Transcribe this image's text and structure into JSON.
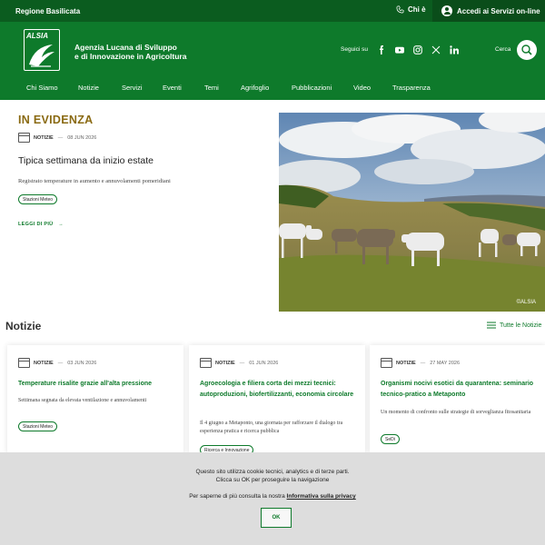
{
  "topbar": {
    "region": "Regione Basilicata",
    "chi_e": "Chi è",
    "login": "Accedi ai Servizi on-line"
  },
  "header": {
    "logo_text": "ALSIA",
    "agency_line1": "Agenzia Lucana di Sviluppo",
    "agency_line2": "e di Innovazione in Agricoltura",
    "follow": "Seguici su",
    "social": [
      "facebook",
      "youtube",
      "instagram",
      "x",
      "linkedin"
    ],
    "search_label": "Cerca"
  },
  "nav": [
    "Chi Siamo",
    "Notizie",
    "Servizi",
    "Eventi",
    "Temi",
    "Agrifoglio",
    "Pubblicazioni",
    "Video",
    "Trasparenza"
  ],
  "featured": {
    "heading": "IN EVIDENZA",
    "category": "NOTIZIE",
    "date": "08 JUN 2026",
    "title": "Tipica settimana da inizio estate",
    "description": "Registrato temperature in aumento e annuvolamenti pomeridiani",
    "tag": "Stazioni Meteo",
    "read_more": "LEGGI DI PIÙ",
    "image_credit": "©ALSIA"
  },
  "news": {
    "heading": "Notizie",
    "all_link": "Tutte le Notizie",
    "cards": [
      {
        "category": "NOTIZIE",
        "date": "03 JUN 2026",
        "title": "Temperature risalite grazie all'alta pressione",
        "desc": "Settimana segnata da elevata ventilazione e annuvolamenti",
        "tag": "Stazioni Meteo"
      },
      {
        "category": "NOTIZIE",
        "date": "01 JUN 2026",
        "title": "Agroecologia e filiera corta dei mezzi tecnici: autoproduzioni, biofertilizzanti, economia circolare",
        "desc": "Il 4 giugno a Metaponto, una giornata per rafforzare il dialogo tra esperienza pratica e ricerca pubblica",
        "tag": "Ricerca e Innovazione"
      },
      {
        "category": "NOTIZIE",
        "date": "27 MAY 2026",
        "title": "Organismi nocivi esotici da quarantena: seminario tecnico-pratico a Metaponto",
        "desc": "Un momento di confronto sulle strategie di sorveglianza fitosanitaria",
        "tag": "SeDi"
      }
    ]
  },
  "cookie": {
    "line1": "Questo sito utilizza cookie tecnici, analytics e di terze parti.",
    "line2": "Clicca su OK per proseguire la navigazione",
    "line3_prefix": "Per saperne di più consulta la nostra",
    "privacy_link": "Informativa sulla privacy",
    "ok": "OK"
  }
}
